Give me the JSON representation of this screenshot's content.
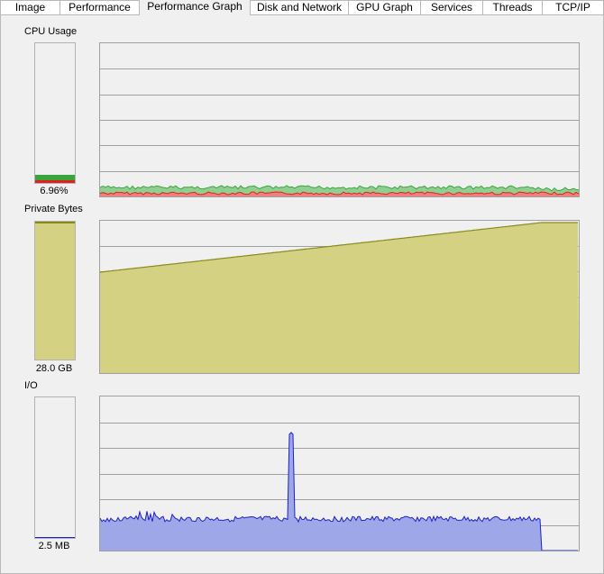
{
  "tabs": [
    {
      "label": "Image"
    },
    {
      "label": "Performance"
    },
    {
      "label": "Performance Graph"
    },
    {
      "label": "Disk and Network"
    },
    {
      "label": "GPU Graph"
    },
    {
      "label": "Services"
    },
    {
      "label": "Threads"
    },
    {
      "label": "TCP/IP"
    }
  ],
  "active_tab": "Performance Graph",
  "sections": {
    "cpu": {
      "label": "CPU Usage",
      "value": "6.96%",
      "meter_percent": 6.96,
      "colors": {
        "kernel": "#e02020",
        "total": "#3aa53a",
        "kernel_fill": "#f08080",
        "total_fill": "#8fcf8f"
      }
    },
    "private_bytes": {
      "label": "Private Bytes",
      "value": "28.0 GB",
      "meter_fraction": 0.98,
      "colors": {
        "line": "#8a8a1a",
        "fill": "#d4d282"
      }
    },
    "io": {
      "label": "I/O",
      "value": "2.5  MB",
      "meter_fraction": 0.0,
      "colors": {
        "line": "#2020c0",
        "fill": "#9ea8e8"
      }
    }
  }
}
